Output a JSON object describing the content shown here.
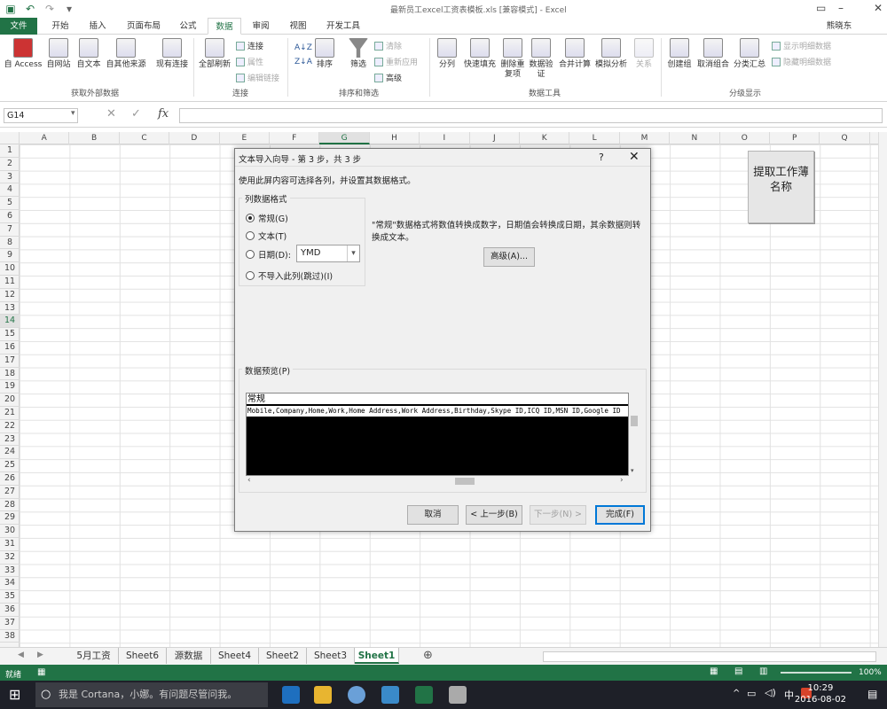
{
  "app": {
    "title": "最新员工excel工资表模板.xls [兼容模式] - Excel",
    "user": "熊晓东",
    "accent_color": "#217346"
  },
  "tabs": [
    "文件",
    "开始",
    "插入",
    "页面布局",
    "公式",
    "数据",
    "审阅",
    "视图",
    "开发工具"
  ],
  "active_tab": "数据",
  "ribbon": {
    "g1": {
      "b1": "自 Access",
      "b2": "自网站",
      "b3": "自文本",
      "b4": "自其他来源",
      "b5": "现有连接",
      "label": "获取外部数据"
    },
    "g2": {
      "b1": "全部刷新",
      "s1": "连接",
      "s2": "属性",
      "s3": "编辑链接",
      "label": "连接"
    },
    "g3": {
      "b1": "排序",
      "b2": "筛选",
      "s1": "清除",
      "s2": "重新应用",
      "s3": "高级",
      "label": "排序和筛选"
    },
    "g4": {
      "b1": "分列",
      "b2": "快速填充",
      "b3": "删除重复项",
      "b4": "数据验证",
      "b5": "合并计算",
      "b6": "模拟分析",
      "b7": "关系",
      "label": "数据工具"
    },
    "g5": {
      "b1": "创建组",
      "b2": "取消组合",
      "b3": "分类汇总",
      "s1": "显示明细数据",
      "s2": "隐藏明细数据",
      "label": "分级显示"
    }
  },
  "formula_bar": {
    "name_box": "G14",
    "fx": "fx",
    "value": ""
  },
  "columns": [
    "A",
    "B",
    "C",
    "D",
    "E",
    "F",
    "G",
    "H",
    "I",
    "J",
    "K",
    "L",
    "M",
    "N",
    "O",
    "P",
    "Q"
  ],
  "selected_column": "G",
  "rows": [
    "1",
    "2",
    "3",
    "4",
    "5",
    "6",
    "7",
    "8",
    "9",
    "10",
    "11",
    "12",
    "13",
    "14",
    "15",
    "16",
    "17",
    "18",
    "19",
    "20",
    "21",
    "22",
    "23",
    "24",
    "25",
    "26",
    "27",
    "28",
    "29",
    "30",
    "31",
    "32",
    "33",
    "34",
    "35",
    "36",
    "37",
    "38"
  ],
  "selected_row": "14",
  "macro_button": "提取工作薄名称",
  "sheets": [
    "5月工资",
    "Sheet6",
    "源数据",
    "Sheet4",
    "Sheet2",
    "Sheet3",
    "Sheet1"
  ],
  "active_sheet": "Sheet1",
  "status": {
    "left": "就绪",
    "zoom": "100%"
  },
  "dialog": {
    "title": "文本导入向导 - 第 3 步，共 3 步",
    "help": "?",
    "close": "✕",
    "description": "使用此屏内容可选择各列，并设置其数据格式。",
    "format_group_title": "列数据格式",
    "options": [
      "常规(G)",
      "文本(T)",
      "日期(D):",
      "不导入此列(跳过)(I)"
    ],
    "selected_option": 0,
    "date_format": "YMD",
    "explanation": "\"常规\"数据格式将数值转换成数字，日期值会转换成日期，其余数据则转换成文本。",
    "advanced_button": "高级(A)...",
    "preview_title": "数据预览(P)",
    "preview_header": "常规",
    "preview_line": "Mobile,Company,Home,Work,Home Address,Work Address,Birthday,Skype ID,ICQ ID,MSN ID,Google ID",
    "buttons": {
      "cancel": "取消",
      "back": "< 上一步(B)",
      "next": "下一步(N) >",
      "finish": "完成(F)"
    }
  },
  "taskbar": {
    "search_placeholder": "我是 Cortana，小娜。有问题尽管问我。",
    "time": "10:29",
    "date": "2016-08-02",
    "ime": "中"
  }
}
